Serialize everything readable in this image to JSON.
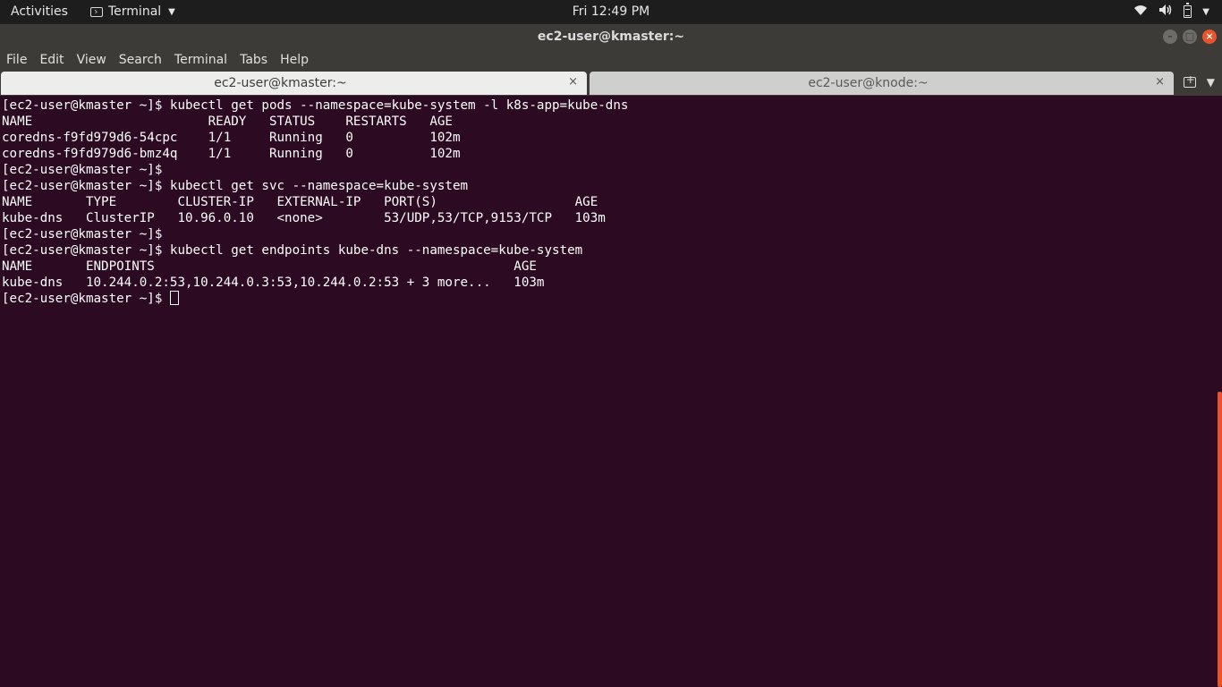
{
  "topbar": {
    "activities": "Activities",
    "app_name": "Terminal",
    "clock": "Fri 12:49 PM",
    "icons": [
      "wifi-icon",
      "volume-icon",
      "battery-icon",
      "chevron-down-icon"
    ]
  },
  "window": {
    "title": "ec2-user@kmaster:~",
    "buttons": {
      "minimize": "–",
      "maximize": "□",
      "close": "×"
    }
  },
  "menubar": {
    "items": [
      "File",
      "Edit",
      "View",
      "Search",
      "Terminal",
      "Tabs",
      "Help"
    ]
  },
  "tabs": [
    {
      "label": "ec2-user@kmaster:~",
      "active": true,
      "close": "×"
    },
    {
      "label": "ec2-user@knode:~",
      "active": false,
      "close": "×"
    }
  ],
  "terminal": {
    "lines": [
      "[ec2-user@kmaster ~]$ kubectl get pods --namespace=kube-system -l k8s-app=kube-dns",
      "NAME                       READY   STATUS    RESTARTS   AGE",
      "coredns-f9fd979d6-54cpc    1/1     Running   0          102m",
      "coredns-f9fd979d6-bmz4q    1/1     Running   0          102m",
      "[ec2-user@kmaster ~]$",
      "[ec2-user@kmaster ~]$ kubectl get svc --namespace=kube-system",
      "NAME       TYPE        CLUSTER-IP   EXTERNAL-IP   PORT(S)                  AGE",
      "kube-dns   ClusterIP   10.96.0.10   <none>        53/UDP,53/TCP,9153/TCP   103m",
      "[ec2-user@kmaster ~]$",
      "[ec2-user@kmaster ~]$ kubectl get endpoints kube-dns --namespace=kube-system",
      "NAME       ENDPOINTS                                               AGE",
      "kube-dns   10.244.0.2:53,10.244.0.3:53,10.244.0.2:53 + 3 more...   103m"
    ],
    "prompt": "[ec2-user@kmaster ~]$ "
  },
  "colors": {
    "terminal_bg": "#2c0a22",
    "accent": "#e9542b"
  }
}
